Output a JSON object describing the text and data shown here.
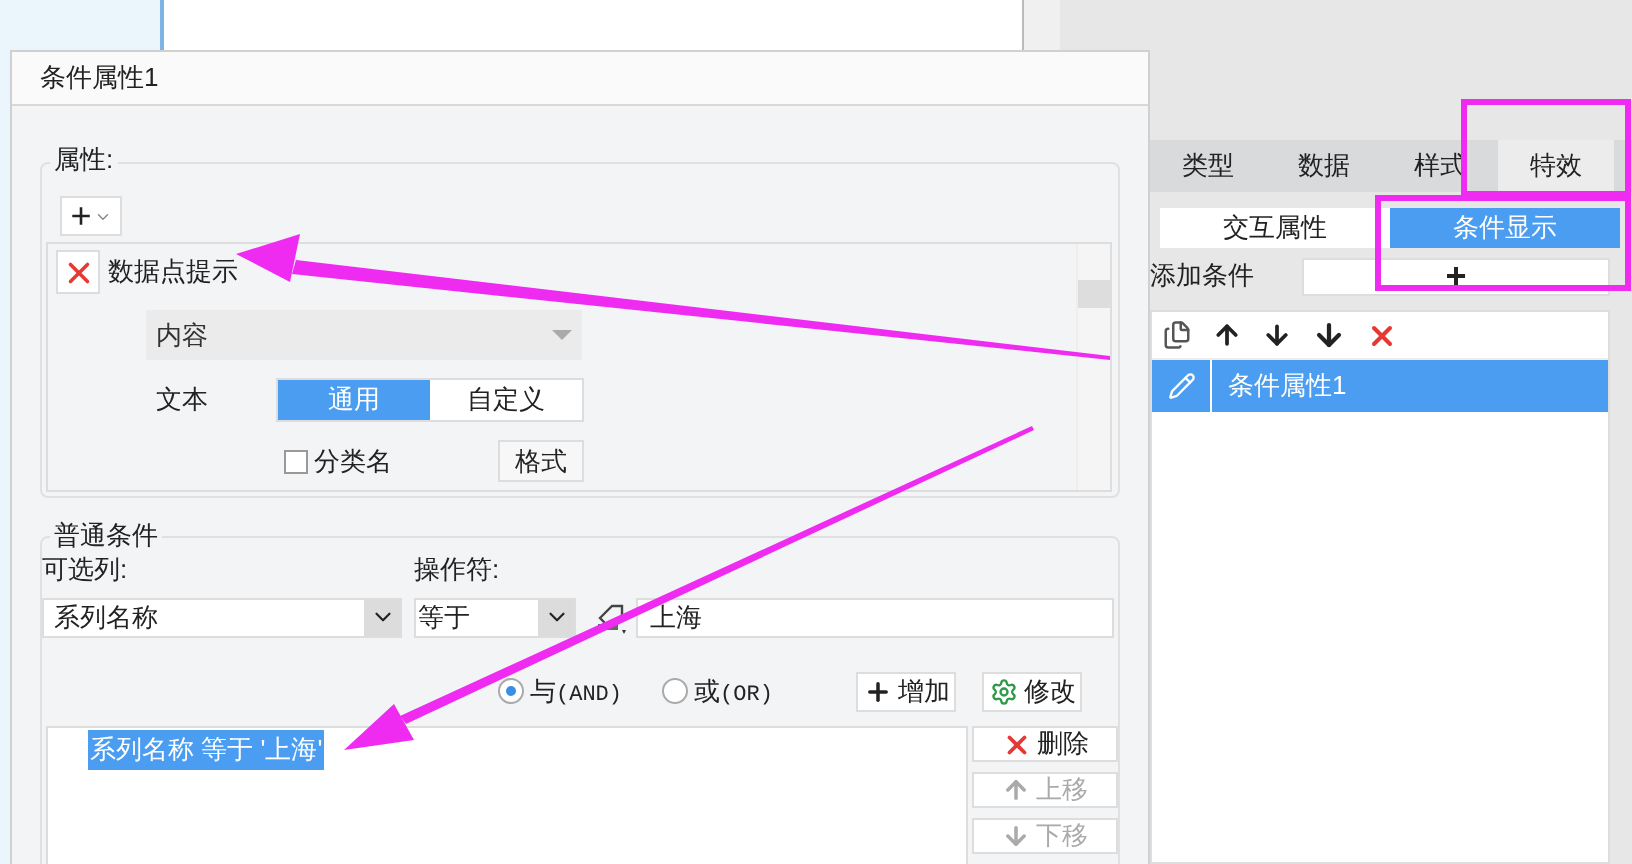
{
  "dialog": {
    "title": "条件属性1",
    "properties": {
      "legend": "属性:",
      "add_button": "+",
      "item": {
        "label": "数据点提示",
        "content_select": "内容",
        "text_label": "文本",
        "segments": [
          {
            "label": "通用",
            "selected": true
          },
          {
            "label": "自定义",
            "selected": false
          }
        ],
        "checkbox": {
          "label": "分类名",
          "checked": false
        },
        "format_button": "格式"
      }
    },
    "conditions": {
      "legend": "普通条件",
      "column_label": "可选列:",
      "operator_label": "操作符:",
      "column_value": "系列名称",
      "operator_value": "等于",
      "value": "上海",
      "logic": [
        {
          "label": "与",
          "suffix": "(AND)",
          "selected": true
        },
        {
          "label": "或",
          "suffix": "(OR)",
          "selected": false
        }
      ],
      "add_button": "增加",
      "edit_button": "修改",
      "list": [
        {
          "text": "系列名称 等于 '上海'",
          "selected": true
        }
      ],
      "side_buttons": [
        {
          "label": "删除",
          "kind": "delete",
          "disabled": false
        },
        {
          "label": "上移",
          "kind": "up",
          "disabled": true
        },
        {
          "label": "下移",
          "kind": "down",
          "disabled": true
        }
      ]
    }
  },
  "panel": {
    "tabs": [
      {
        "label": "类型",
        "selected": false
      },
      {
        "label": "数据",
        "selected": false
      },
      {
        "label": "样式",
        "selected": false
      },
      {
        "label": "特效",
        "selected": true
      }
    ],
    "subtabs": [
      {
        "label": "交互属性",
        "selected": false
      },
      {
        "label": "条件显示",
        "selected": true
      }
    ],
    "add_condition_label": "添加条件",
    "add_condition_button": "+",
    "conditions": [
      {
        "label": "条件属性1",
        "selected": true
      }
    ]
  }
}
